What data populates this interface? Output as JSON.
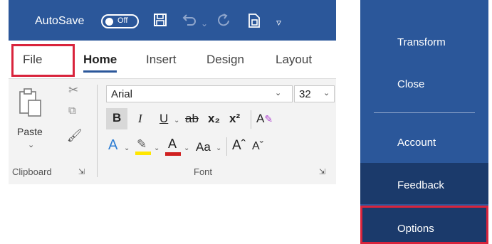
{
  "quick_access": {
    "autosave_label": "AutoSave",
    "autosave_toggle": "Off",
    "save_icon": "save-icon",
    "undo_icon": "undo-icon",
    "redo_icon": "redo-icon",
    "touch_icon": "touch-mode-icon",
    "customize_icon": "customize-qat-icon"
  },
  "tabs": [
    {
      "label": "File"
    },
    {
      "label": "Home",
      "active": true
    },
    {
      "label": "Insert"
    },
    {
      "label": "Design"
    },
    {
      "label": "Layout"
    }
  ],
  "clipboard": {
    "paste_label": "Paste",
    "group_label": "Clipboard"
  },
  "font": {
    "family": "Arial",
    "size": "32",
    "group_label": "Font",
    "bold": "B",
    "italic": "I",
    "underline": "U",
    "strikethrough": "ab",
    "subscript": "x₂",
    "superscript": "x²",
    "change_case": "Aa",
    "grow": "Aˆ",
    "shrink": "Aˇ"
  },
  "backstage": {
    "items": [
      {
        "label": "Transform"
      },
      {
        "label": "Close"
      },
      {
        "label": "Account"
      },
      {
        "label": "Feedback"
      },
      {
        "label": "Options"
      }
    ]
  },
  "colors": {
    "ribbon_blue": "#2b579a",
    "backstage_dark": "#1b3a6b",
    "highlight_red": "#d9243c"
  }
}
